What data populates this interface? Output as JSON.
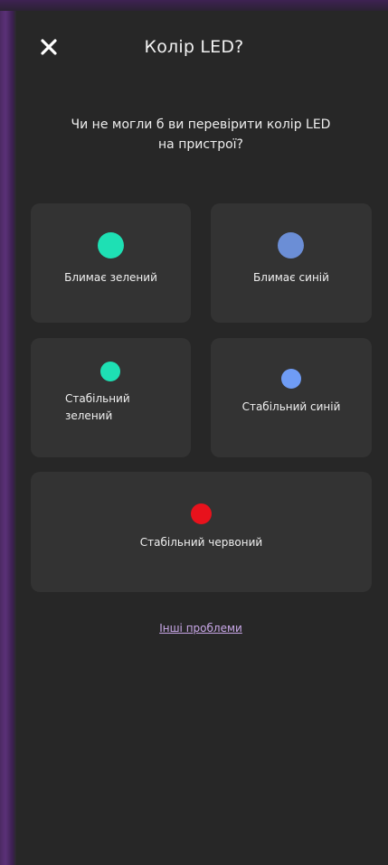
{
  "header": {
    "title": "Колір LED?",
    "close_icon": "close-icon"
  },
  "question": "Чи не могли б ви перевірити колір LED на пристрої?",
  "options": [
    {
      "label": "Блимає зелений",
      "color": "#1ee0b4"
    },
    {
      "label": "Блимає синій",
      "color": "#6b8ed6"
    },
    {
      "label": "Стабільний зелений",
      "color": "#1ee0b4"
    },
    {
      "label": "Стабільний синій",
      "color": "#6f9cf5"
    },
    {
      "label": "Стабільний червоний",
      "color": "#e8121c"
    }
  ],
  "footer_link": "Інші проблеми",
  "colors": {
    "background": "#272727",
    "card": "#333333",
    "link": "#c9a8e8",
    "frame": "#5b3178"
  }
}
